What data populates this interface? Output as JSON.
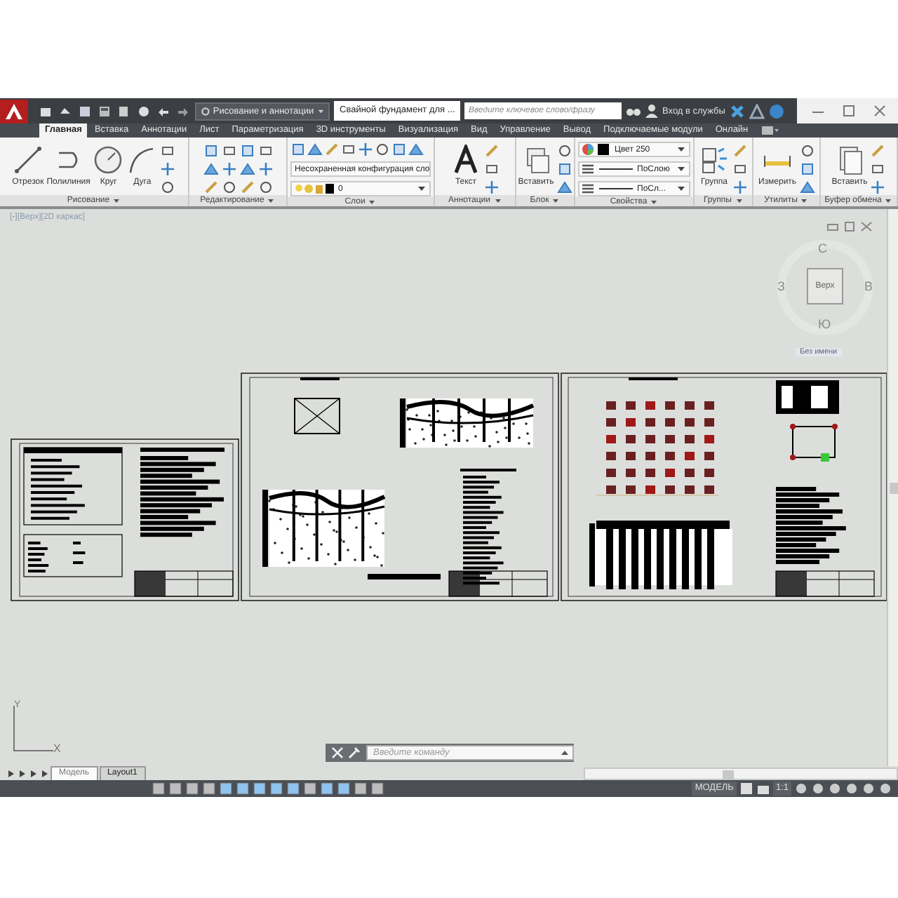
{
  "title_bar": {
    "workspace": "Рисование и аннотации",
    "document_title": "Свайной фундамент для ...",
    "search": {
      "placeholder": "Введите ключевое слово/фразу"
    },
    "sign_in": "Вход в службы"
  },
  "ribbon_tabs": [
    {
      "label": "Главная",
      "selected": true
    },
    {
      "label": "Вставка",
      "selected": false
    },
    {
      "label": "Аннотации",
      "selected": false
    },
    {
      "label": "Лист",
      "selected": false
    },
    {
      "label": "Параметризация",
      "selected": false
    },
    {
      "label": "3D инструменты",
      "selected": false
    },
    {
      "label": "Визуализация",
      "selected": false
    },
    {
      "label": "Вид",
      "selected": false
    },
    {
      "label": "Управление",
      "selected": false
    },
    {
      "label": "Вывод",
      "selected": false
    },
    {
      "label": "Подключаемые модули",
      "selected": false
    },
    {
      "label": "Онлайн",
      "selected": false
    }
  ],
  "ribbon_panels": [
    {
      "title": "Рисование",
      "tools": [
        {
          "kind": "large",
          "label": "Отрезок"
        },
        {
          "kind": "large",
          "label": "Полилиния"
        },
        {
          "kind": "large",
          "label": "Круг"
        },
        {
          "kind": "large",
          "label": "Дуга"
        },
        {
          "kind": "icon-column"
        }
      ]
    },
    {
      "title": "Редактирование",
      "tools": [
        {
          "kind": "icon-column"
        },
        {
          "kind": "icon-column"
        },
        {
          "kind": "icon-column"
        },
        {
          "kind": "icon-column"
        }
      ]
    },
    {
      "title": "Слои",
      "tools": [
        {
          "kind": "stack",
          "items": [
            {
              "kind": "icon-row"
            },
            {
              "kind": "combo",
              "value": "Несохраненная конфигурация сло"
            },
            {
              "kind": "layer-combo",
              "value": "0"
            }
          ]
        }
      ]
    },
    {
      "title": "Аннотации",
      "tools": [
        {
          "kind": "large",
          "label": "Текст"
        },
        {
          "kind": "icon-column"
        }
      ]
    },
    {
      "title": "Блок",
      "tools": [
        {
          "kind": "large",
          "label": "Вставить"
        },
        {
          "kind": "icon-column"
        }
      ]
    },
    {
      "title": "Свойства",
      "tools": [
        {
          "kind": "stack",
          "items": [
            {
              "kind": "color-combo",
              "value": "Цвет 250"
            },
            {
              "kind": "line-combo",
              "value": "ПоСлою"
            },
            {
              "kind": "line-combo",
              "value": "ПоСл..."
            }
          ]
        }
      ]
    },
    {
      "title": "Группы",
      "tools": [
        {
          "kind": "large",
          "label": "Группа"
        },
        {
          "kind": "icon-column"
        }
      ]
    },
    {
      "title": "Утилиты",
      "tools": [
        {
          "kind": "large",
          "label": "Измерить"
        },
        {
          "kind": "icon-column"
        }
      ]
    },
    {
      "title": "Буфер обмена",
      "tools": [
        {
          "kind": "large",
          "label": "Вставить"
        },
        {
          "kind": "icon-column"
        }
      ]
    }
  ],
  "viewport": {
    "label": "[-][Верх][2D каркас]",
    "viewcube": {
      "north": "С",
      "west": "З",
      "face": "Верх",
      "east": "В",
      "south": "Ю",
      "ucs_name": "Без имени"
    },
    "ucs_axes": {
      "y": "Y",
      "x": "X"
    }
  },
  "command_line": {
    "placeholder": "Введите команду"
  },
  "layout_tabs": [
    {
      "label": "Модель",
      "selected": true
    },
    {
      "label": "Layout1",
      "selected": false
    }
  ],
  "status_bar": {
    "space": "МОДЕЛЬ",
    "scale": "1:1"
  }
}
